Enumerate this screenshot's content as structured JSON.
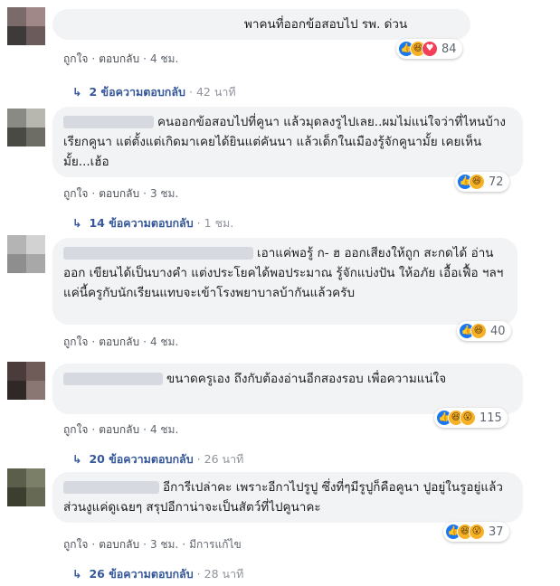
{
  "comments": [
    {
      "text": "พาคนที่ออกข้อสอบไป รพ. ด่วน",
      "like": "ถูกใจ",
      "reply": "ตอบกลับ",
      "time": "4 ชม.",
      "reactions": [
        "like-icon",
        "haha-icon",
        "love-icon"
      ],
      "count": "84",
      "replies": {
        "count": "2 ข้อความตอบกลับ",
        "time": "42 นาที"
      }
    },
    {
      "text": "คนออกข้อสอบไปที่คูนา แล้วมุดลงรูไปเลย..ผมไม่แน่ใจว่าที่ไหนบ้างเรียกคูนา แต่ตั้งแต่เกิดมาเคยได้ยินแต่คันนา แล้วเด็กในเมืองรู้จักคูนามั้ย เคยเห็นมั้ย...เฮ้อ",
      "like": "ถูกใจ",
      "reply": "ตอบกลับ",
      "time": "3 ชม.",
      "reactions": [
        "like-icon",
        "haha-icon"
      ],
      "count": "72",
      "replies": {
        "count": "14 ข้อความตอบกลับ",
        "time": "1 ชม."
      }
    },
    {
      "text": "เอาแค่พอรู้ ก- ฮ ออกเสียงให้ถูก สะกดได้ อ่านออก เขียนได้เป็นบางคำ แต่งประโยคได้พอประมาณ รู้จักแบ่งปัน ให้อภัย เอื้อเฟื้อ ฯลฯ แค่นี้ครูกับนักเรียนแทบจะเข้าโรงพยาบาลบ้ากันแล้วครับ",
      "like": "ถูกใจ",
      "reply": "ตอบกลับ",
      "time": "4 ชม.",
      "reactions": [
        "like-icon",
        "haha-icon"
      ],
      "count": "40"
    },
    {
      "text": "ขนาดครูเอง ถึงกับต้องอ่านอีกสองรอบ เพื่อความแน่ใจ",
      "like": "ถูกใจ",
      "reply": "ตอบกลับ",
      "time": "4 ชม.",
      "reactions": [
        "like-icon",
        "haha-icon",
        "wow-icon"
      ],
      "count": "115",
      "replies": {
        "count": "20 ข้อความตอบกลับ",
        "time": "26 นาที"
      }
    },
    {
      "text": "อีการีเปล่าคะ เพราะอีกาไปรูปู ซึ่งที่ๆมีรูปูก็คือคูนา ปูอยู่ในรูอยู่แล้ว ส่วนงูแค่ดูเฉยๆ สรุปอีกาน่าจะเป็นสัตว์ที่ไปคูนาคะ",
      "like": "ถูกใจ",
      "reply": "ตอบกลับ",
      "time": "3 ชม.",
      "edited": "มีการแก้ไข",
      "reactions": [
        "like-icon",
        "haha-icon",
        "wow-icon"
      ],
      "count": "37",
      "replies": {
        "count": "26 ข้อความตอบกลับ",
        "time": "28 นาที"
      }
    }
  ],
  "dot": "·",
  "colors": {
    "link": "#365899",
    "bubble": "#f2f3f5",
    "like": "#1877f2",
    "haha": "#f7b125",
    "love": "#f33e58"
  }
}
